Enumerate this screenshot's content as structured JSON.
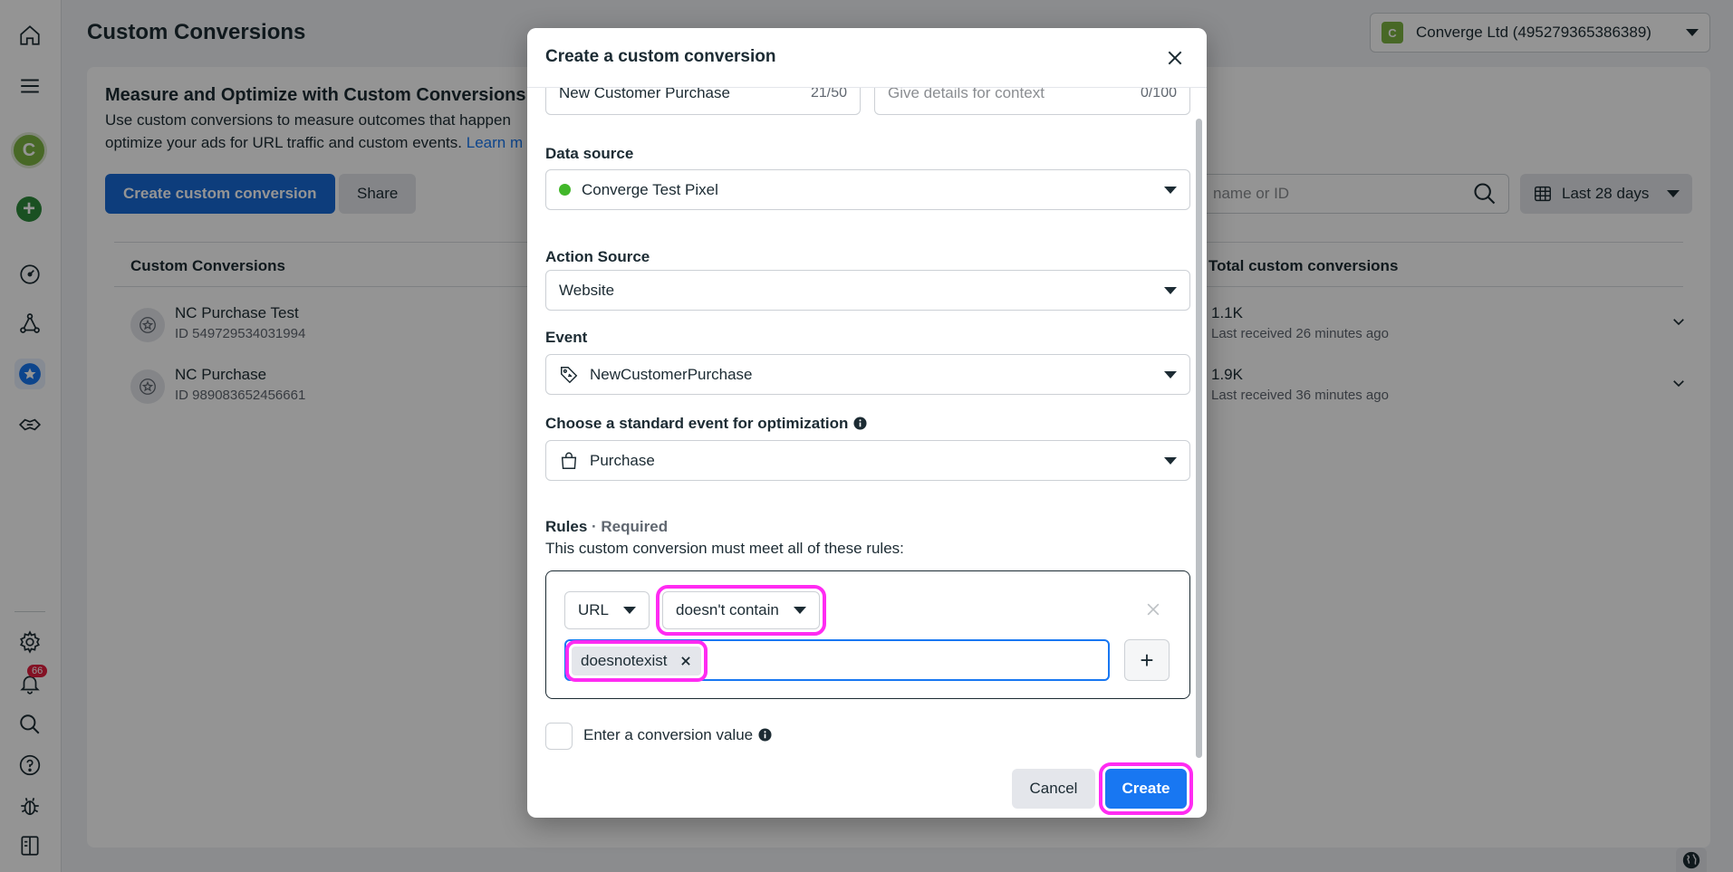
{
  "page": {
    "title": "Custom Conversions",
    "account": {
      "avatar_letter": "C",
      "label": "Converge Ltd (495279365386389)"
    }
  },
  "sidebar": {
    "avatar_letter": "C",
    "plus": "+",
    "notification_count": "66",
    "colors": {
      "active_bg": "#e7f0fd",
      "avatar": "#7cb342",
      "plus": "#2e8b3b",
      "badge": "#e41e3f"
    }
  },
  "intro": {
    "heading": "Measure and Optimize with Custom Conversions",
    "line1": "Use custom conversions to measure outcomes that happen",
    "line2": "optimize your ads for URL traffic and custom events.",
    "link": "Learn m"
  },
  "toolbar": {
    "create_label": "Create custom conversion",
    "share_label": "Share",
    "search_text": "name or ID",
    "date_label": "Last 28 days"
  },
  "table": {
    "col_name": "Custom Conversions",
    "col_total": "Total custom conversions",
    "rows": [
      {
        "name": "NC Purchase Test",
        "id": "ID 549729534031994",
        "total": "1.1K",
        "received": "Last received 26 minutes ago"
      },
      {
        "name": "NC Purchase",
        "id": "ID 989083652456661",
        "total": "1.9K",
        "received": "Last received 36 minutes ago"
      }
    ]
  },
  "modal": {
    "title": "Create a custom conversion",
    "name_value": "New Customer Purchase",
    "name_counter": "21/50",
    "desc_placeholder": "Give details for context",
    "desc_counter": "0/100",
    "data_source_label": "Data source",
    "data_source_value": "Converge Test Pixel",
    "action_source_label": "Action Source",
    "action_source_value": "Website",
    "event_label": "Event",
    "event_value": "NewCustomerPurchase",
    "standard_event_label": "Choose a standard event for optimization",
    "standard_event_value": "Purchase",
    "rules_label": "Rules",
    "rules_required": " · Required",
    "rules_desc": "This custom conversion must meet all of these rules:",
    "rule_field": "URL",
    "rule_condition": "doesn't contain",
    "rule_value": "doesnotexist",
    "add_rule": "+",
    "conversion_value_label": "Enter a conversion value",
    "cancel_label": "Cancel",
    "create_label": "Create",
    "colors": {
      "primary": "#1877f2",
      "highlight": "#ff2bf2",
      "pixel_status": "#42b72a"
    }
  }
}
